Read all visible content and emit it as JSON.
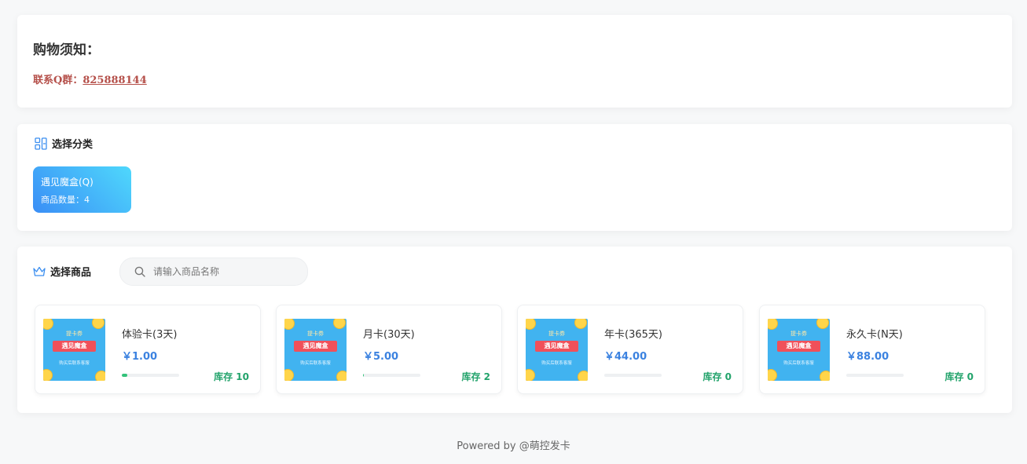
{
  "notice": {
    "title": "购物须知：",
    "contact_label": "联系Q群：",
    "contact_value": "825888144"
  },
  "category": {
    "title": "选择分类",
    "icon": "category-grid-icon",
    "items": [
      {
        "name": "遇见魔盒(Q)",
        "count_label": "商品数量：4"
      }
    ]
  },
  "goods": {
    "title": "选择商品",
    "icon": "crown-icon",
    "search_placeholder": "请输入商品名称",
    "thumbnail": {
      "top_text": "提卡券",
      "banner_text": "遇见魔盒",
      "bottom_text": "购买后联系客服"
    },
    "items": [
      {
        "name": "体验卡(3天)",
        "price": "￥1.00",
        "stock_label": "库存 10",
        "stock_fill": 0.1
      },
      {
        "name": "月卡(30天)",
        "price": "￥5.00",
        "stock_label": "库存 2",
        "stock_fill": 0.02
      },
      {
        "name": "年卡(365天)",
        "price": "￥44.00",
        "stock_label": "库存 0",
        "stock_fill": 0
      },
      {
        "name": "永久卡(N天)",
        "price": "￥88.00",
        "stock_label": "库存 0",
        "stock_fill": 0
      }
    ]
  },
  "footer": {
    "text": "Powered by @萌控发卡"
  },
  "colors": {
    "accent": "#3b82e0",
    "stock": "#22a36b",
    "notice_red": "#b5504a"
  }
}
